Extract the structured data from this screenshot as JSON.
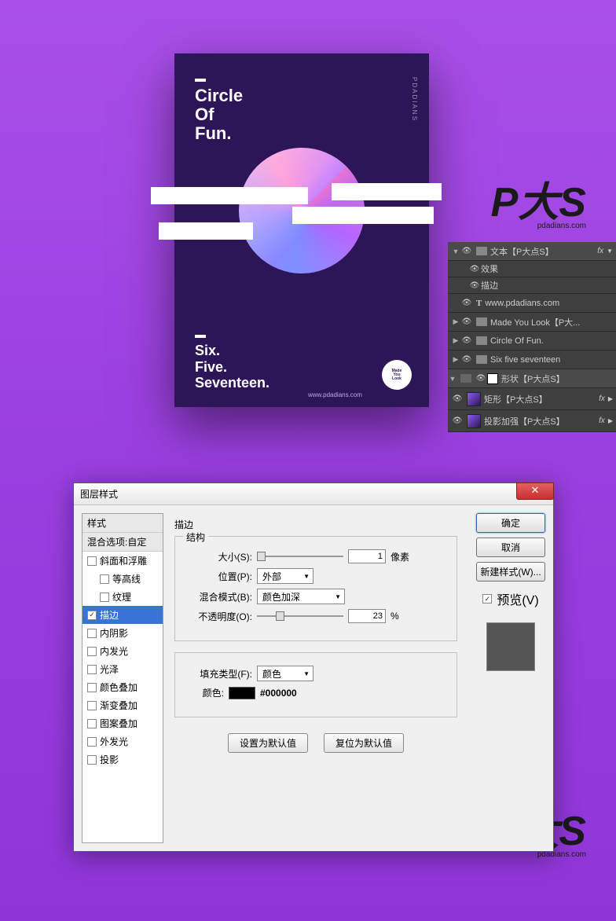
{
  "poster": {
    "title": "Circle\nOf\nFun.",
    "subtitle": "Six.\nFive.\nSeventeen.",
    "url": "www.pdadians.com",
    "badge": "Made\nYou\nLook",
    "side": "PDADIANS"
  },
  "watermark": {
    "text": "P大S",
    "url": "pdadians.com"
  },
  "layers": {
    "r1": {
      "name": "文本【P大点S】",
      "fx": "fx"
    },
    "r2": {
      "name": "效果"
    },
    "r3": {
      "name": "描边"
    },
    "r4": {
      "name": "www.pdadians.com"
    },
    "r5": {
      "name": "Made You Look【P大..."
    },
    "r6": {
      "name": "Circle Of Fun."
    },
    "r7": {
      "name": "Six five seventeen"
    },
    "r8": {
      "name": "形状【P大点S】"
    },
    "r9": {
      "name": "矩形【P大点S】",
      "fx": "fx"
    },
    "r10": {
      "name": "投影加强【P大点S】",
      "fx": "fx"
    }
  },
  "dialog": {
    "title": "图层样式",
    "styles_header": "样式",
    "blend_defaults": "混合选项:自定",
    "s": {
      "bevel": "斜面和浮雕",
      "contour": "等高线",
      "texture": "纹理",
      "stroke": "描边",
      "innershadow": "内阴影",
      "innerglow": "内发光",
      "satin": "光泽",
      "coloroverlay": "颜色叠加",
      "gradoverlay": "渐变叠加",
      "patoverlay": "图案叠加",
      "outerglow": "外发光",
      "dropshadow": "投影"
    },
    "fs_stroke": "描边",
    "fs_struct": "结构",
    "size_l": "大小(S):",
    "size_v": "1",
    "size_u": "像素",
    "pos_l": "位置(P):",
    "pos_v": "外部",
    "blend_l": "混合模式(B):",
    "blend_v": "颜色加深",
    "opa_l": "不透明度(O):",
    "opa_v": "23",
    "opa_u": "%",
    "fill_l": "填充类型(F):",
    "fill_v": "颜色",
    "color_l": "颜色:",
    "color_v": "#000000",
    "btn_def": "设置为默认值",
    "btn_reset": "复位为默认值",
    "ok": "确定",
    "cancel": "取消",
    "newstyle": "新建样式(W)...",
    "preview": "预览(V)"
  }
}
